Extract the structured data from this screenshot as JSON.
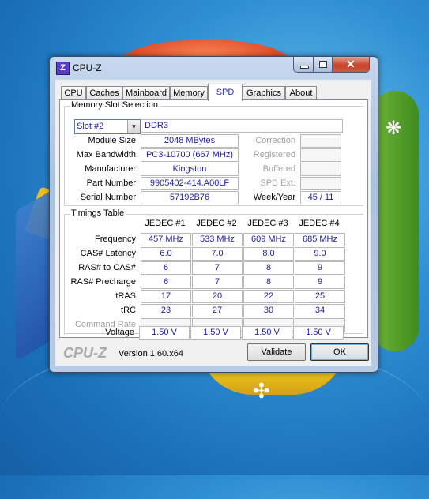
{
  "window": {
    "title": "CPU-Z",
    "app_icon_text": "Z"
  },
  "tabs": [
    {
      "label": "CPU"
    },
    {
      "label": "Caches"
    },
    {
      "label": "Mainboard"
    },
    {
      "label": "Memory"
    },
    {
      "label": "SPD",
      "active": true
    },
    {
      "label": "Graphics"
    },
    {
      "label": "About"
    }
  ],
  "slot": {
    "group_title": "Memory Slot Selection",
    "selected": "Slot #2",
    "type": "DDR3",
    "labels": {
      "module_size": "Module Size",
      "max_bandwidth": "Max Bandwidth",
      "manufacturer": "Manufacturer",
      "part_number": "Part Number",
      "serial_number": "Serial Number",
      "correction": "Correction",
      "registered": "Registered",
      "buffered": "Buffered",
      "spd_ext": "SPD Ext.",
      "week_year": "Week/Year"
    },
    "values": {
      "module_size": "2048 MBytes",
      "max_bandwidth": "PC3-10700 (667 MHz)",
      "manufacturer": "Kingston",
      "part_number": "9905402-414.A00LF",
      "serial_number": "57192B76",
      "week_year": "45 / 11"
    }
  },
  "timings": {
    "group_title": "Timings Table",
    "columns": [
      "JEDEC #1",
      "JEDEC #2",
      "JEDEC #3",
      "JEDEC #4"
    ],
    "rows": [
      {
        "label": "Frequency",
        "values": [
          "457 MHz",
          "533 MHz",
          "609 MHz",
          "685 MHz"
        ]
      },
      {
        "label": "CAS# Latency",
        "values": [
          "6.0",
          "7.0",
          "8.0",
          "9.0"
        ]
      },
      {
        "label": "RAS# to CAS#",
        "values": [
          "6",
          "7",
          "8",
          "9"
        ]
      },
      {
        "label": "RAS# Precharge",
        "values": [
          "6",
          "7",
          "8",
          "9"
        ]
      },
      {
        "label": "tRAS",
        "values": [
          "17",
          "20",
          "22",
          "25"
        ]
      },
      {
        "label": "tRC",
        "values": [
          "23",
          "27",
          "30",
          "34"
        ]
      },
      {
        "label": "Command Rate",
        "values": [
          "",
          "",
          "",
          ""
        ]
      },
      {
        "label": "Voltage",
        "values": [
          "1.50 V",
          "1.50 V",
          "1.50 V",
          "1.50 V"
        ]
      }
    ]
  },
  "footer": {
    "brand": "CPU-Z",
    "version": "Version 1.60.x64",
    "validate_label": "Validate",
    "ok_label": "OK"
  }
}
